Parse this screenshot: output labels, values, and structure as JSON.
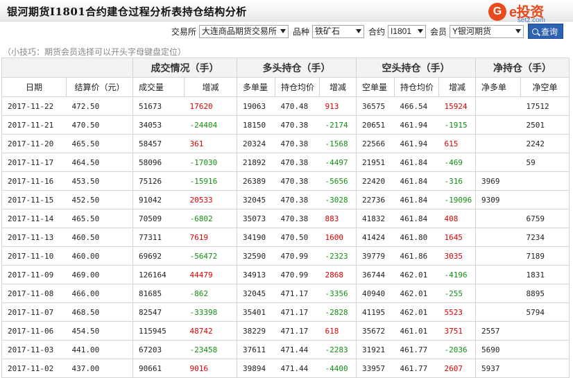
{
  "header": {
    "title": "银河期货I1801合约建仓过程分析表持仓结构分析",
    "logo_mark": "G",
    "logo_text": "e投资",
    "logo_url": "setz.com"
  },
  "filters": {
    "exchange_label": "交易所",
    "exchange_value": "大连商品期货交易所",
    "product_label": "品种",
    "product_value": "铁矿石",
    "contract_label": "合约",
    "contract_value": "I1801",
    "member_label": "会员",
    "member_value": "Y银河期货",
    "query_label": "查询"
  },
  "tip": "（小技巧：期货会员选择可以开头字母键盘定位）",
  "table": {
    "groups": [
      "成交情况（手）",
      "多头持仓（手）",
      "空头持仓（手）",
      "净持仓（手）"
    ],
    "columns": [
      "日期",
      "结算价（元）",
      "成交量",
      "增减",
      "多单量",
      "持仓均价",
      "增减",
      "空单量",
      "持仓均价",
      "增减",
      "净多单",
      "净空单"
    ],
    "rows": [
      [
        "2017-11-22",
        "472.50",
        "51673",
        "17620",
        "19063",
        "470.48",
        "913",
        "36575",
        "466.54",
        "15924",
        "",
        "17512"
      ],
      [
        "2017-11-21",
        "470.50",
        "34053",
        "-24404",
        "18150",
        "470.38",
        "-2174",
        "20651",
        "461.94",
        "-1915",
        "",
        "2501"
      ],
      [
        "2017-11-20",
        "465.50",
        "58457",
        "361",
        "20324",
        "470.38",
        "-1568",
        "22566",
        "461.94",
        "615",
        "",
        "2242"
      ],
      [
        "2017-11-17",
        "464.50",
        "58096",
        "-17030",
        "21892",
        "470.38",
        "-4497",
        "21951",
        "461.84",
        "-469",
        "",
        "59"
      ],
      [
        "2017-11-16",
        "453.50",
        "75126",
        "-15916",
        "26389",
        "470.38",
        "-5656",
        "22420",
        "461.84",
        "-316",
        "3969",
        ""
      ],
      [
        "2017-11-15",
        "452.50",
        "91042",
        "20533",
        "32045",
        "470.38",
        "-3028",
        "22736",
        "461.84",
        "-19096",
        "9309",
        ""
      ],
      [
        "2017-11-14",
        "465.50",
        "70509",
        "-6802",
        "35073",
        "470.38",
        "883",
        "41832",
        "461.84",
        "408",
        "",
        "6759"
      ],
      [
        "2017-11-13",
        "460.50",
        "77311",
        "7619",
        "34190",
        "470.50",
        "1600",
        "41424",
        "461.80",
        "1645",
        "",
        "7234"
      ],
      [
        "2017-11-10",
        "460.00",
        "69692",
        "-56472",
        "32590",
        "470.99",
        "-2323",
        "39779",
        "461.86",
        "3035",
        "",
        "7189"
      ],
      [
        "2017-11-09",
        "469.00",
        "126164",
        "44479",
        "34913",
        "470.99",
        "2868",
        "36744",
        "462.01",
        "-4196",
        "",
        "1831"
      ],
      [
        "2017-11-08",
        "466.00",
        "81685",
        "-862",
        "32045",
        "471.17",
        "-3356",
        "40940",
        "462.01",
        "-255",
        "",
        "8895"
      ],
      [
        "2017-11-07",
        "468.50",
        "82547",
        "-33398",
        "35401",
        "471.17",
        "-2828",
        "41195",
        "462.01",
        "5523",
        "",
        "5794"
      ],
      [
        "2017-11-06",
        "454.50",
        "115945",
        "48742",
        "38229",
        "471.17",
        "618",
        "35672",
        "461.01",
        "3751",
        "2557",
        ""
      ],
      [
        "2017-11-03",
        "441.00",
        "67203",
        "-23458",
        "37611",
        "471.44",
        "-2283",
        "31921",
        "461.77",
        "-2036",
        "5690",
        ""
      ],
      [
        "2017-11-02",
        "437.00",
        "90661",
        "9016",
        "39894",
        "471.44",
        "-4400",
        "33957",
        "461.77",
        "2607",
        "5937",
        ""
      ]
    ],
    "colors": {
      "up": "#e00000",
      "down": "#129012"
    }
  }
}
